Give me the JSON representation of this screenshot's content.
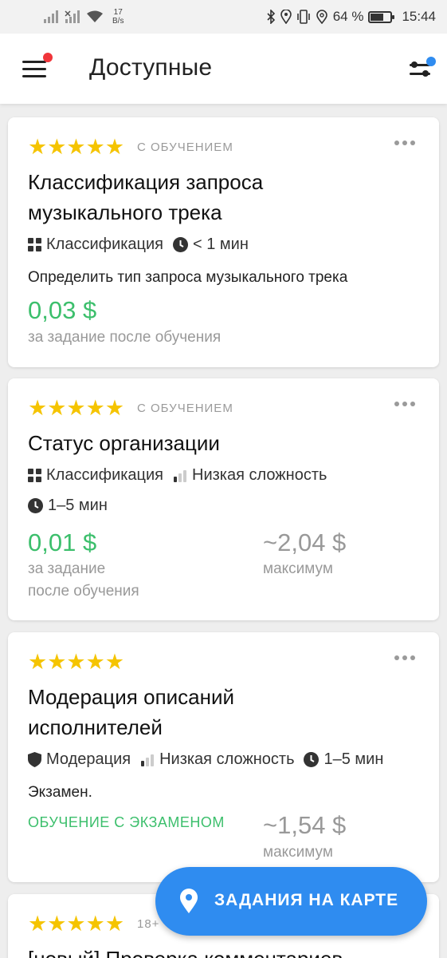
{
  "status_bar": {
    "speed_value": "17",
    "speed_unit": "B/s",
    "battery": "64 %",
    "time": "15:44"
  },
  "header": {
    "title": "Доступные",
    "menu_icon": "hamburger-icon",
    "filter_icon": "sliders-icon"
  },
  "tasks": [
    {
      "stars": "★★★★★",
      "badge": "С ОБУЧЕНИЕМ",
      "title_line1": "Классификация запроса",
      "title_line2": "музыкального трека",
      "category": "Классификация",
      "duration": "< 1 мин",
      "description": "Определить тип запроса музыкального трека",
      "price": "0,03 $",
      "price_note": "за задание после обучения"
    },
    {
      "stars": "★★★★★",
      "badge": "С ОБУЧЕНИЕМ",
      "title": "Статус организации",
      "category": "Классификация",
      "difficulty": "Низкая сложность",
      "duration": "1–5 мин",
      "price": "0,01 $",
      "price_note_line1": "за задание",
      "price_note_line2": "после обучения",
      "max_price": "~2,04 $",
      "max_label": "максимум"
    },
    {
      "stars": "★★★★★",
      "title_line1": "Модерация описаний",
      "title_line2": "исполнителей",
      "category": "Модерация",
      "difficulty": "Низкая сложность",
      "duration": "1–5 мин",
      "description": "Экзамен.",
      "training": "ОБУЧЕНИЕ С ЭКЗАМЕНОМ",
      "max_price": "~1,54 $",
      "max_label": "максимум"
    },
    {
      "stars": "★★★★★",
      "badge": "18+",
      "title": "[новый] Проверка комментариев"
    }
  ],
  "fab": {
    "label": "ЗАДАНИЯ НА КАРТЕ",
    "icon": "map-pin-icon"
  },
  "colors": {
    "accent_blue": "#2f8cf0",
    "price_green": "#3cbf6c",
    "star_yellow": "#f5c400",
    "notification_red": "#f0353a"
  }
}
